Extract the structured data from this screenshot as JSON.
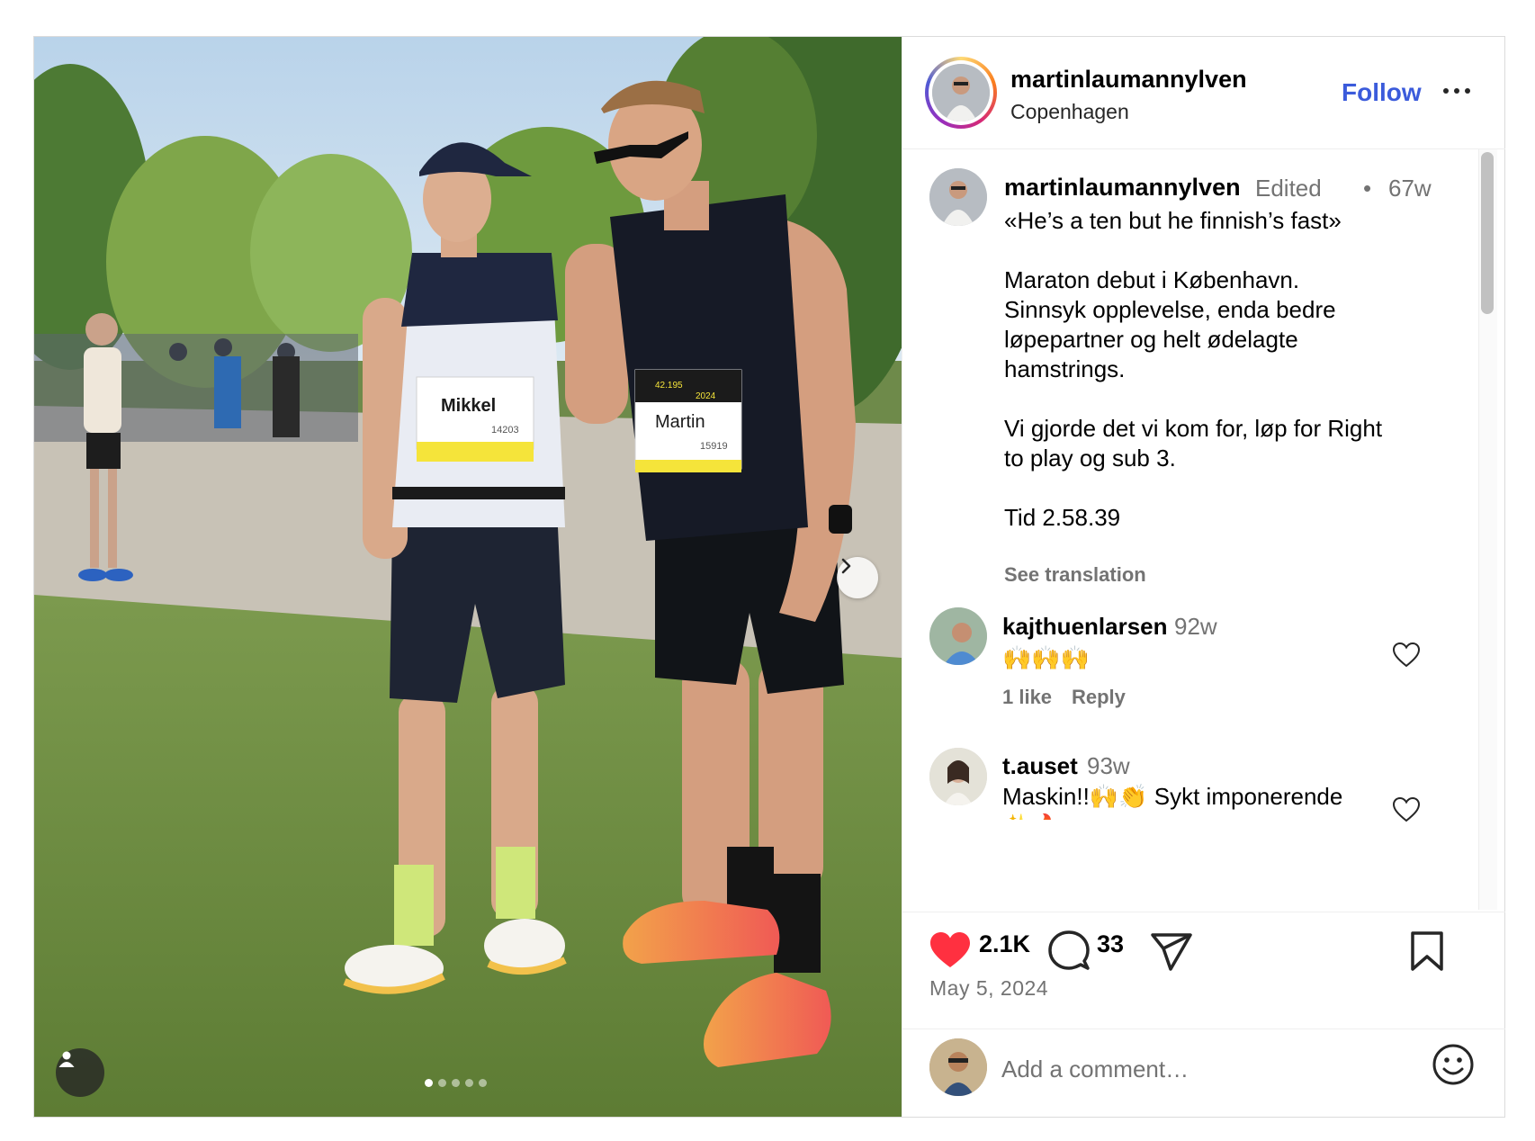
{
  "post": {
    "username": "martinlaumannylven",
    "location": "Copenhagen",
    "follow_label": "Follow",
    "more_icon": "more-horizontal-icon",
    "media": {
      "bib_left": "Mikkel",
      "bib_left_number": "14203",
      "bib_right": "Martin",
      "bib_right_number": "15919",
      "bib_right_top": "42.195",
      "bib_right_year": "2024",
      "carousel_count": 5,
      "carousel_active_index": 0
    }
  },
  "caption": {
    "username": "martinlaumannylven",
    "edited_label": "Edited",
    "separator": "•",
    "time": "67w",
    "text": "«He’s a ten but he finnish’s fast»\n\nMaraton debut i København.\nSinnsyk opplevelse, enda bedre\nløpepartner og helt ødelagte\nhamstrings.\n\nVi gjorde det vi kom for, løp for Right\nto play og sub 3.\n\nTid 2.58.39",
    "see_translation": "See translation"
  },
  "comments": [
    {
      "username": "kajthuenlarsen",
      "time": "92w",
      "text": "🙌🙌🙌",
      "likes_label": "1 like",
      "reply_label": "Reply"
    },
    {
      "username": "t.auset",
      "time": "93w",
      "text": "Maskin!!🙌👏 Sykt imponerende\n✨🔥"
    }
  ],
  "actions": {
    "likes": "2.1K",
    "comments": "33",
    "date": "May 5, 2024",
    "liked": true,
    "like_color": "#ff3040"
  },
  "add_comment": {
    "placeholder": "Add a comment…"
  },
  "colors": {
    "follow_blue": "#3b5bdb",
    "muted_text": "#737373",
    "like_red": "#ff3040"
  }
}
